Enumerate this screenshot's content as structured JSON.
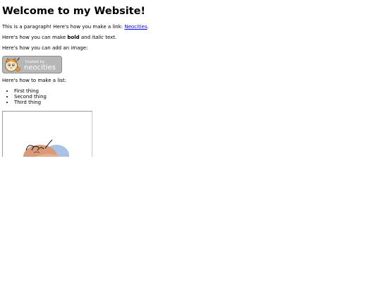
{
  "page": {
    "heading": "Welcome to my Website!",
    "para1_prefix": "This is a paragraph! Here's how you make a link: ",
    "link_text": "Neocities",
    "para1_suffix": ".",
    "para2_prefix": "Here's how you can make ",
    "bold_text": "bold",
    "para2_and": " and ",
    "italic_text": "italic",
    "para2_suffix": " text.",
    "image_intro": "Here's how you can add an image:",
    "badge": {
      "small_text": "hosted by",
      "brand_text": "neocities",
      "icon": "neocities-cat-logo"
    },
    "list_intro": "Here's how to make a list:",
    "list_items": [
      "First thing",
      "Second thing",
      "Third thing"
    ],
    "embedded_frame": {
      "icon": "avatar-illustration"
    }
  },
  "colors": {
    "link": "#0000ee",
    "badge_bg": "#b7b7b7",
    "text": "#000000"
  }
}
